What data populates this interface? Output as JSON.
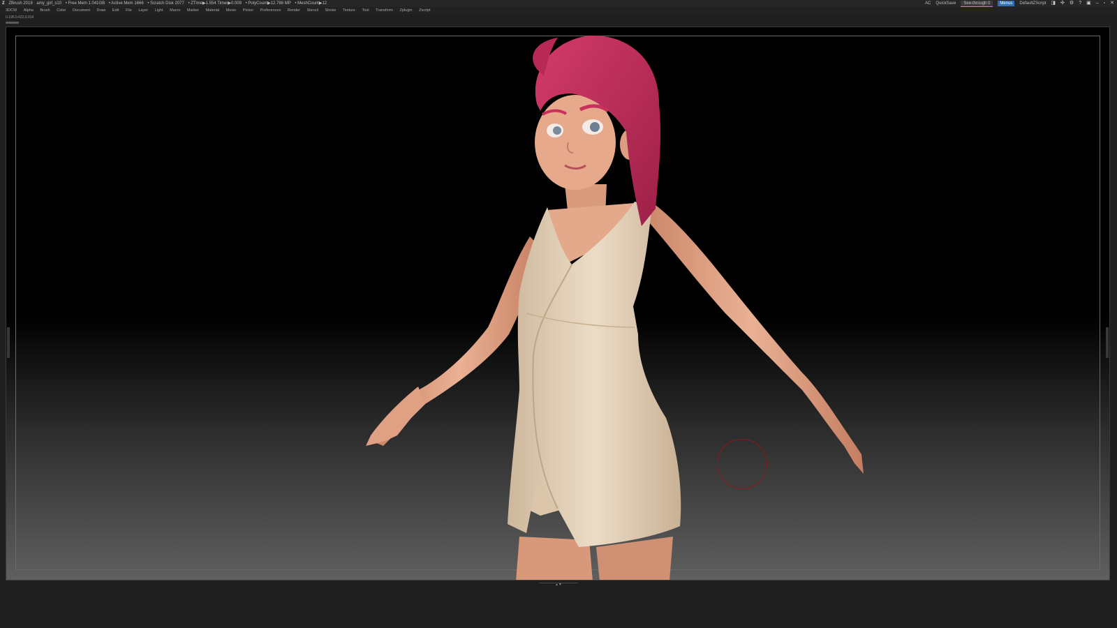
{
  "titlebar": {
    "app_name": "ZBrush 2019",
    "file_name": "amy_girl_s10",
    "stats": [
      "• Free Mem 1.041GB",
      "• Active Mem 1666",
      "• Scratch Disk 2077",
      "• ZTime▶1.554 Timer▶0.009",
      "• PolyCount▶12.786 MP",
      "• MeshCount▶12"
    ],
    "ac": "AC",
    "quicksave": "QuickSave",
    "see_through": "See-through  0",
    "menus": "Menus",
    "script": "DefaultZScript"
  },
  "menubar": {
    "items": [
      "3DCW",
      "Alpha",
      "Brush",
      "Color",
      "Document",
      "Draw",
      "Edit",
      "File",
      "Layer",
      "Light",
      "Macro",
      "Marker",
      "Material",
      "Movie",
      "Picker",
      "Preferences",
      "Render",
      "Stencil",
      "Stroke",
      "Texture",
      "Tool",
      "Transform",
      "Zplugin",
      "Zscript"
    ]
  },
  "infobar": {
    "coords": "0.195,0.622,0.014"
  },
  "colors": {
    "hair": "#c8305e",
    "skin": "#e9a788",
    "dress": "#e8d6bf",
    "accent": "#2f6fb6"
  }
}
